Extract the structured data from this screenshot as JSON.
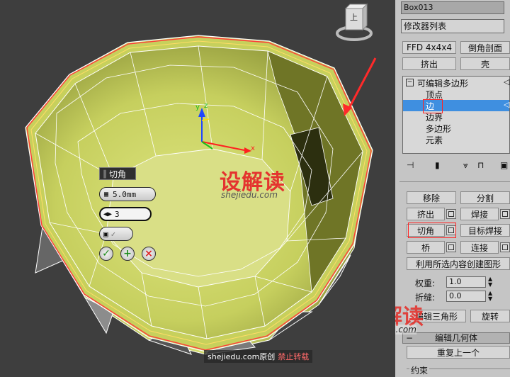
{
  "object_name": "Box013",
  "modifier_list_label": "修改器列表",
  "modifier_buttons": [
    "FFD 4x4x4",
    "倒角剖面",
    "挤出",
    "壳"
  ],
  "stack": {
    "root": "可编辑多边形",
    "items": [
      "顶点",
      "边",
      "边界",
      "多边形",
      "元素"
    ],
    "selected": "边"
  },
  "edit_edges": {
    "remove": "移除",
    "split": "分割",
    "extrude": "挤出",
    "weld": "焊接",
    "chamfer": "切角",
    "target_weld": "目标焊接",
    "bridge": "桥",
    "connect": "连接",
    "create_shape": "利用所选内容创建图形",
    "weight_label": "权重:",
    "weight_value": "1.0",
    "crease_label": "折缝:",
    "crease_value": "0.0",
    "edit_tri": "编辑三角形",
    "turn": "旋转"
  },
  "edit_geometry": {
    "title": "编辑几何体",
    "repeat_last": "重复上一个",
    "constraints": "约束"
  },
  "caddy": {
    "title": "切角",
    "amount": "5.0mm",
    "segments": "3"
  },
  "gizmo": {
    "x": "x",
    "y": "y",
    "z": "z"
  },
  "viewcube": {
    "face": "上"
  },
  "watermark": {
    "logo": "设解读",
    "url": "shejiedu.com",
    "credit_site": "shejiedu.com",
    "credit_orig": "原创",
    "credit_forbid": "禁止转载"
  },
  "colors": {
    "mesh": "#c8d25e",
    "selection": "#ff3b3b",
    "panel": "#c5c5c5",
    "highlight": "#3f8fe0",
    "watermark": "#e4342f"
  }
}
